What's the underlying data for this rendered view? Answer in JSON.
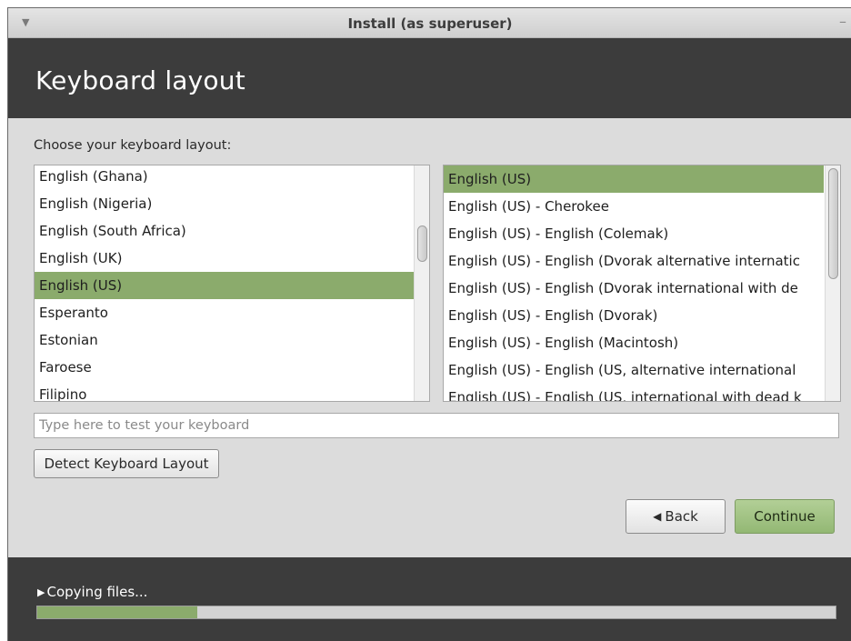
{
  "window": {
    "title": "Install (as superuser)",
    "menu_icon": "chevron-down-icon",
    "minimize_icon": "minimize-icon"
  },
  "header": {
    "title": "Keyboard layout"
  },
  "prompt": "Choose your keyboard layout:",
  "layouts": {
    "items": [
      "English (Ghana)",
      "English (Nigeria)",
      "English (South Africa)",
      "English (UK)",
      "English (US)",
      "Esperanto",
      "Estonian",
      "Faroese",
      "Filipino"
    ],
    "selected": "English (US)"
  },
  "variants": {
    "items": [
      "English (US)",
      "English (US) - Cherokee",
      "English (US) - English (Colemak)",
      "English (US) - English (Dvorak alternative internatic",
      "English (US) - English (Dvorak international with de",
      "English (US) - English (Dvorak)",
      "English (US) - English (Macintosh)",
      "English (US) - English (US, alternative international",
      "English (US) - English (US, international with dead k"
    ],
    "selected": "English (US)"
  },
  "test_input": {
    "placeholder": "Type here to test your keyboard",
    "value": ""
  },
  "buttons": {
    "detect": "Detect Keyboard Layout",
    "back": "Back",
    "back_icon": "back-arrow-icon",
    "continue": "Continue"
  },
  "footer": {
    "status": "Copying files...",
    "status_icon": "expander-triangle-icon",
    "progress": 0.2
  },
  "colors": {
    "accent": "#8bab6c",
    "banner": "#3c3c3c",
    "window_bg": "#dcdcdc"
  }
}
